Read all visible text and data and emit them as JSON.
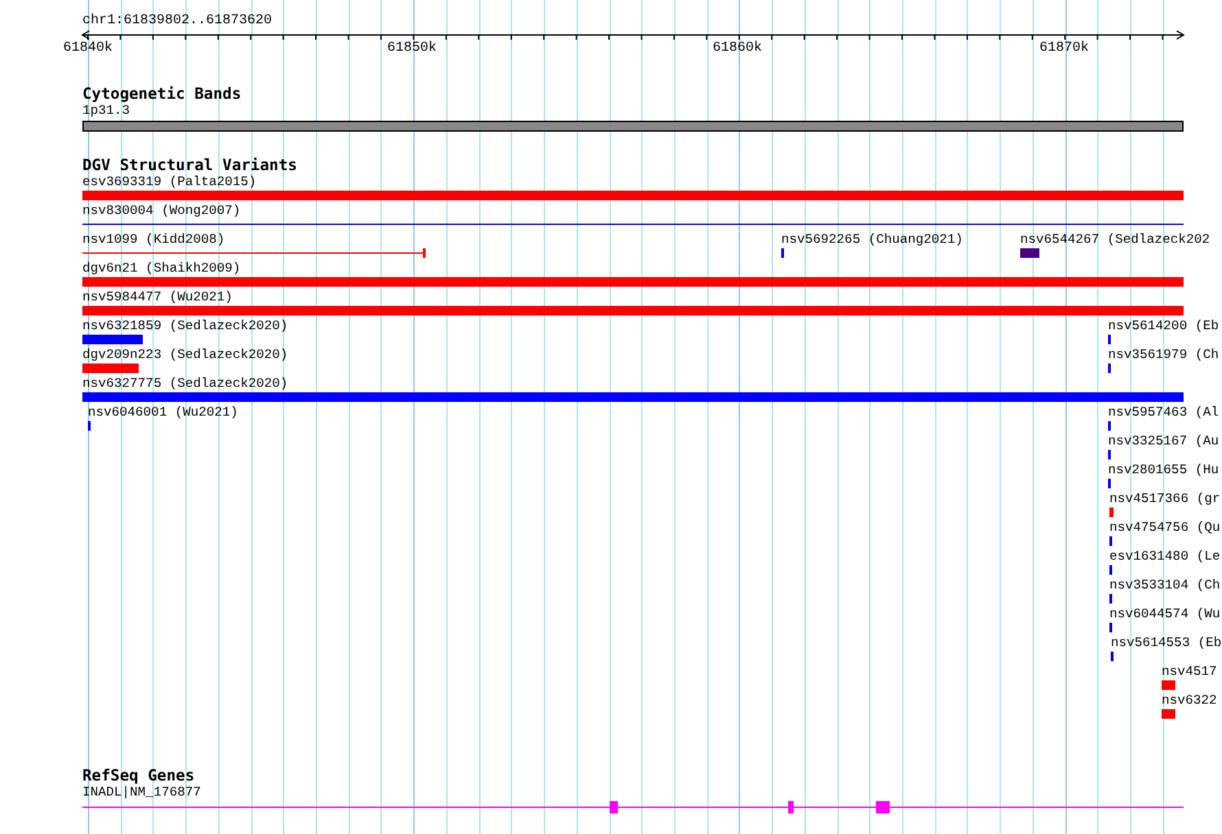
{
  "ruler": {
    "title": "chr1:61839802..61873620",
    "ticks": [
      {
        "label": "61840k"
      },
      {
        "label": "61850k"
      },
      {
        "label": "61860k"
      },
      {
        "label": "61870k"
      }
    ]
  },
  "cytogenetic_bands": {
    "title": "Cytogenetic Bands",
    "bands": [
      {
        "label": "1p31.3"
      }
    ]
  },
  "dgv": {
    "title": "DGV Structural Variants",
    "rows": [
      {
        "features": [
          {
            "label": "esv3693319 (Palta2015)",
            "kind": "bar",
            "color": "#ff0000"
          }
        ]
      },
      {
        "features": [
          {
            "label": "nsv830004 (Wong2007)",
            "kind": "line",
            "color": "#0000ff"
          }
        ]
      },
      {
        "features": [
          {
            "label": "nsv1099 (Kidd2008)",
            "kind": "line",
            "color": "#ff0000"
          },
          {
            "label": "nsv5692265 (Chuang2021)",
            "kind": "bar",
            "color": "#0000ff"
          },
          {
            "label": "nsv6544267 (Sedlazeck202",
            "kind": "bar",
            "color": "#4b0082"
          }
        ]
      },
      {
        "features": [
          {
            "label": "dgv6n21 (Shaikh2009)",
            "kind": "bar",
            "color": "#ff0000"
          }
        ]
      },
      {
        "features": [
          {
            "label": "nsv5984477 (Wu2021)",
            "kind": "bar",
            "color": "#ff0000"
          }
        ]
      },
      {
        "features": [
          {
            "label": "nsv6321859 (Sedlazeck2020)",
            "kind": "bar",
            "color": "#0000ff"
          },
          {
            "label": "nsv5614200 (Eb",
            "kind": "bar",
            "color": "#0000ff"
          }
        ]
      },
      {
        "features": [
          {
            "label": "dgv209n223 (Sedlazeck2020)",
            "kind": "bar",
            "color": "#ff0000"
          },
          {
            "label": "nsv3561979 (Ch",
            "kind": "bar",
            "color": "#0000ff"
          }
        ]
      },
      {
        "features": [
          {
            "label": "nsv6327775 (Sedlazeck2020)",
            "kind": "bar",
            "color": "#0000ff"
          }
        ]
      },
      {
        "features": [
          {
            "label": "nsv6046001 (Wu2021)",
            "kind": "bar",
            "color": "#0000ff"
          },
          {
            "label": "nsv5957463 (Al",
            "kind": "bar",
            "color": "#0000ff"
          }
        ]
      },
      {
        "features": [
          {
            "label": "nsv3325167 (Au",
            "kind": "bar",
            "color": "#0000ff"
          }
        ]
      },
      {
        "features": [
          {
            "label": "nsv2801655 (Hu",
            "kind": "bar",
            "color": "#0000ff"
          }
        ]
      },
      {
        "features": [
          {
            "label": "nsv4517366 (gr",
            "kind": "bar",
            "color": "#ff0000"
          }
        ]
      },
      {
        "features": [
          {
            "label": "nsv4754756 (Qu",
            "kind": "bar",
            "color": "#0000ff"
          }
        ]
      },
      {
        "features": [
          {
            "label": "esv1631480 (Le",
            "kind": "bar",
            "color": "#0000ff"
          }
        ]
      },
      {
        "features": [
          {
            "label": "nsv3533104 (Ch",
            "kind": "bar",
            "color": "#0000ff"
          }
        ]
      },
      {
        "features": [
          {
            "label": "nsv6044574 (Wu",
            "kind": "bar",
            "color": "#0000ff"
          }
        ]
      },
      {
        "features": [
          {
            "label": "nsv5614553 (Eb",
            "kind": "bar",
            "color": "#0000ff"
          }
        ]
      },
      {
        "features": [
          {
            "label": "nsv4517",
            "kind": "bar",
            "color": "#ff0000"
          }
        ]
      },
      {
        "features": [
          {
            "label": "nsv6322",
            "kind": "bar",
            "color": "#ff0000"
          }
        ]
      }
    ]
  },
  "refseq": {
    "title": "RefSeq Genes",
    "genes": [
      {
        "label": "INADL|NM_176877"
      }
    ]
  }
}
